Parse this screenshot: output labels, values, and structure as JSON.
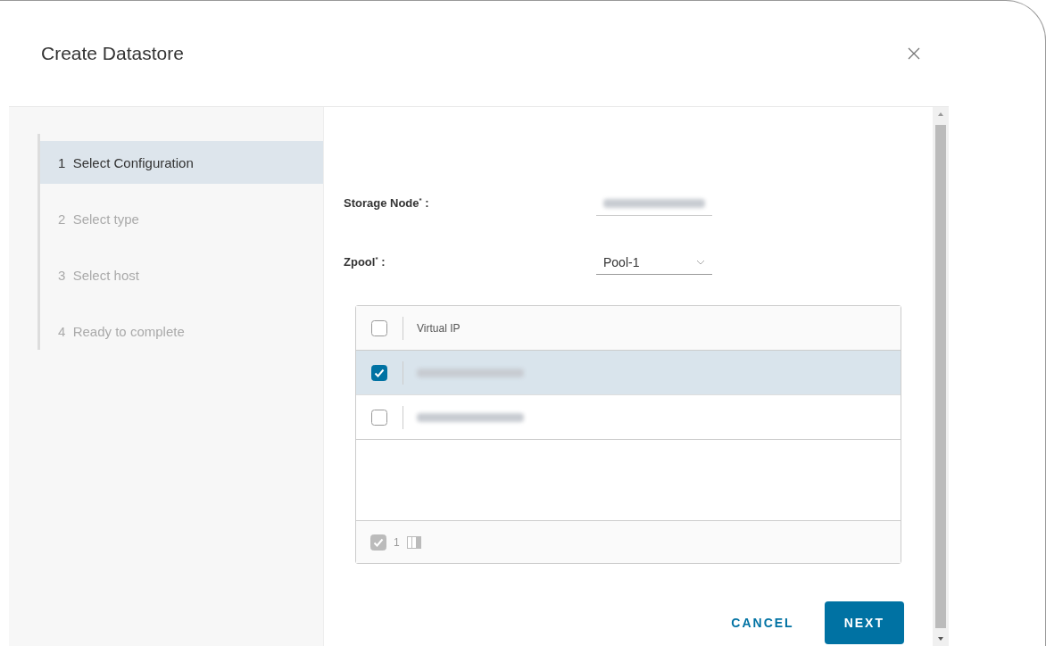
{
  "dialog": {
    "title": "Create Datastore"
  },
  "steps": [
    {
      "number": "1",
      "label": "Select Configuration",
      "selected": true
    },
    {
      "number": "2",
      "label": "Select type",
      "selected": false
    },
    {
      "number": "3",
      "label": "Select host",
      "selected": false
    },
    {
      "number": "4",
      "label": "Ready to complete",
      "selected": false
    }
  ],
  "fields": [
    {
      "label": "Storage Node$^{*}$ :",
      "kind": "redacted"
    },
    {
      "label": "Zpool$^{*}$ :",
      "kind": "select",
      "value": "Pool-1"
    }
  ],
  "grid": {
    "columns": [
      "Virtual IP"
    ],
    "header_checked": false,
    "rows": [
      {
        "selected": true
      },
      {
        "selected": false
      }
    ],
    "footer": {
      "selected_count": "1"
    }
  },
  "buttons": [
    {
      "label": "CANCEL",
      "kind": "secondary"
    },
    {
      "label": "NEXT",
      "kind": "primary"
    }
  ]
}
